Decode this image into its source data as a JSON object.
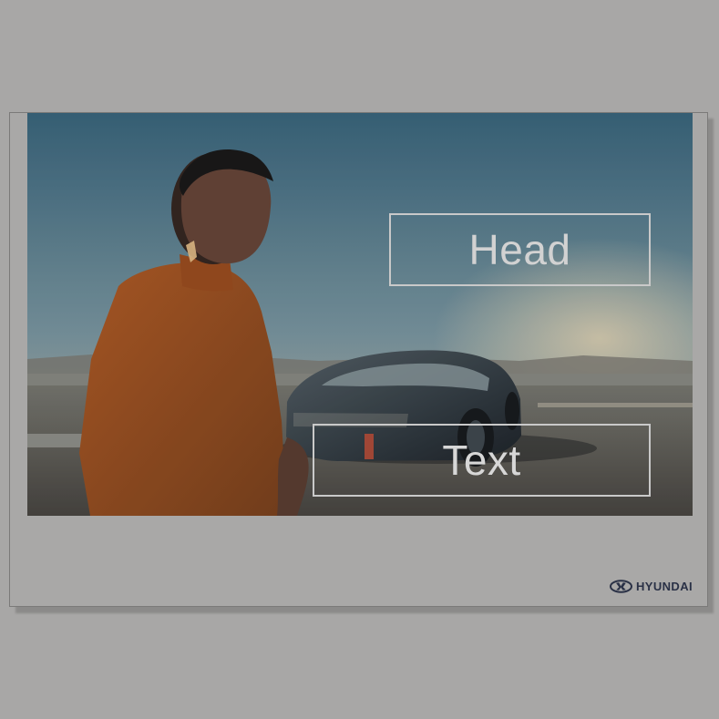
{
  "document": {
    "head_placeholder": "Head",
    "text_placeholder": "Text",
    "brand_word": "HYUNDAI"
  },
  "icons": {
    "brand": "hyundai-logo-icon"
  },
  "colors": {
    "page_background": "#a8a7a6",
    "card_background": "#a9a8a7",
    "logo": "#2a3146",
    "overlay_text": "#d2d2d2"
  }
}
